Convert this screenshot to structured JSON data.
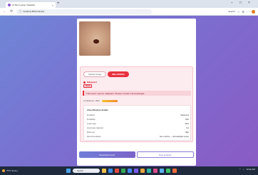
{
  "browser": {
    "tab_title": "AI Skin Lesion Classifier",
    "new_tab": "+",
    "url": "localhost:8501/classify",
    "search_label": "Search",
    "win_min": "–",
    "win_max": "□",
    "win_close": "×"
  },
  "result": {
    "secondary_button": "Upload image",
    "danger_button": "MELANOMA",
    "warning_text": "Malignant",
    "chip_text": "HIGH",
    "alert_text": "This lesion may be malignant. Please consult a dermatologist.",
    "confidence_label": "Confidence: 93%",
    "confidence_value": 0.93
  },
  "details": {
    "title": "Classification details",
    "rows": [
      {
        "label": "Prediction",
        "value": "Melanoma"
      },
      {
        "label": "Probability",
        "value": "93%"
      },
      {
        "label": "Lesion type",
        "value": "Mole"
      },
      {
        "label": "Asymmetry detected",
        "value": "Yes"
      },
      {
        "label": "Risk level",
        "value": "High"
      },
      {
        "label": "Recommendation",
        "value": "See a doctor — dermatologist review"
      }
    ]
  },
  "footer": {
    "primary": "Download report",
    "outline": "New analysis"
  },
  "taskbar": {
    "weather": "75°F Sunny",
    "search": "Search",
    "time": "10:42 AM"
  },
  "colors": {
    "accent": "#e8323f",
    "brand": "#7a6fd0"
  }
}
